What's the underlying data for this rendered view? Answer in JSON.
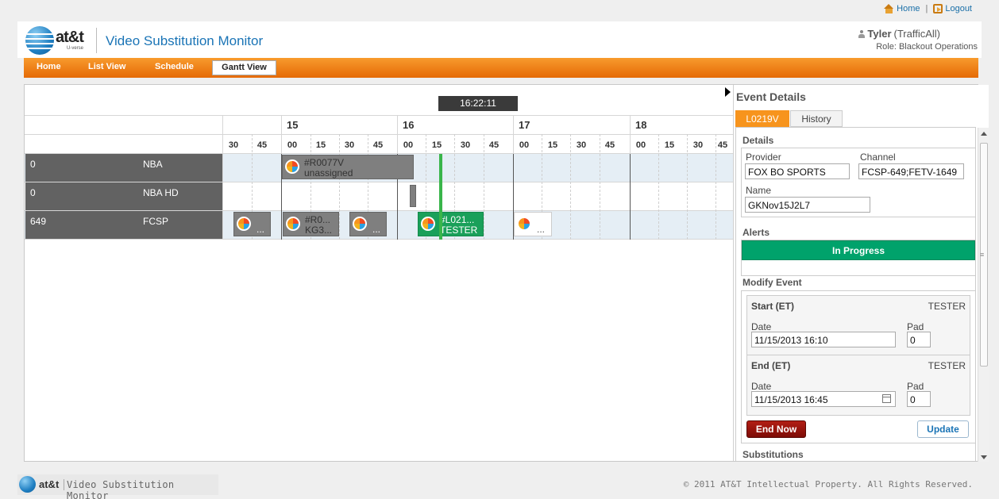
{
  "toplinks": {
    "home": "Home",
    "sep": "|",
    "logout": "Logout"
  },
  "header": {
    "brand": "at&t",
    "brand_sub": "U-verse",
    "app_title": "Video Substitution Monitor",
    "user_name": "Tyler",
    "user_group": "(TrafficAll)",
    "role": "Role: Blackout Operations"
  },
  "nav": {
    "home": "Home",
    "list_view": "List View",
    "schedule": "Schedule",
    "gantt_view": "Gantt View"
  },
  "clock": "16:22:11",
  "gantt": {
    "hours": [
      "15",
      "16",
      "17",
      "18"
    ],
    "minutes": [
      "30",
      "45",
      "00",
      "15",
      "30",
      "45",
      "00",
      "15",
      "30",
      "45",
      "00",
      "15",
      "30",
      "45",
      "00",
      "15",
      "30",
      "45"
    ],
    "channels": [
      {
        "number": "0",
        "name": "NBA"
      },
      {
        "number": "0",
        "name": "NBA HD"
      },
      {
        "number": "649",
        "name": "FCSP"
      }
    ],
    "events": {
      "nba_1": {
        "line1": "#R0077V",
        "line2": "unassigned"
      },
      "fcsp_1": {
        "dots": "..."
      },
      "fcsp_2": {
        "line1": "#R0...",
        "line2": "KG3..."
      },
      "fcsp_3": {
        "dots": "..."
      },
      "fcsp_4": {
        "line1": "#L021...",
        "line2": "TESTER"
      },
      "fcsp_5": {
        "dots": "..."
      }
    }
  },
  "details": {
    "title": "Event Details",
    "tabs": [
      "L0219V",
      "History"
    ],
    "section_details": "Details",
    "provider_label": "Provider",
    "provider_value": "FOX BO SPORTS",
    "channel_label": "Channel",
    "channel_value": "FCSP-649;FETV-1649",
    "name_label": "Name",
    "name_value": "GKNov15J2L7",
    "section_alerts": "Alerts",
    "alert_status": "In Progress",
    "section_modify": "Modify Event",
    "start_label": "Start (ET)",
    "start_user": "TESTER",
    "start_date_label": "Date",
    "start_date": "11/15/2013 16:10",
    "start_pad_label": "Pad",
    "start_pad": "0",
    "end_label": "End (ET)",
    "end_user": "TESTER",
    "end_date_label": "Date",
    "end_date": "11/15/2013 16:45",
    "end_pad_label": "Pad",
    "end_pad": "0",
    "end_now": "End Now",
    "update": "Update",
    "section_subs": "Substitutions"
  },
  "footer": {
    "brand": "at&t",
    "app": "Video Substitution Monitor",
    "copyright": "© 2011 AT&T Intellectual Property. All Rights Reserved."
  },
  "colors": {
    "accent": "#f7941d",
    "nav": "#e56a06",
    "in_progress": "#00a26b",
    "now_line": "#39b54a",
    "event_active": "#1aa05a"
  }
}
